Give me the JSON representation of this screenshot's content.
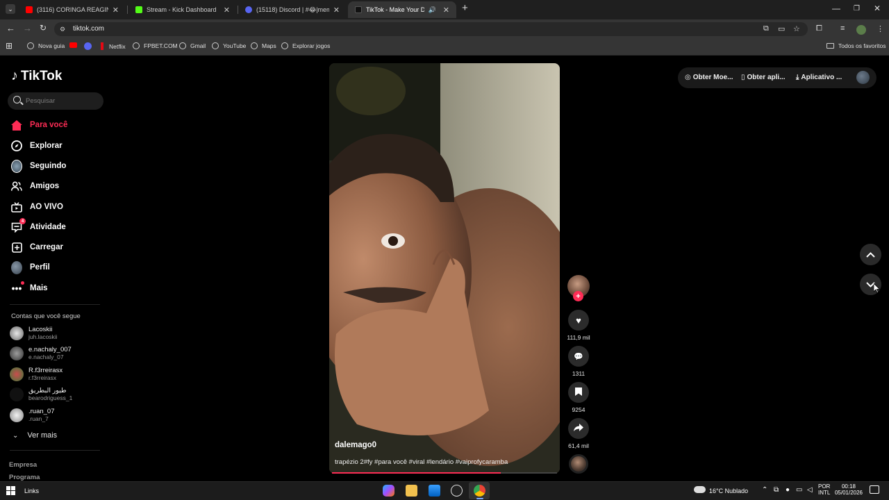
{
  "browser": {
    "tabs": [
      {
        "title": "(3116) CORINGA REAGINDO AO",
        "fav_color": "#ff0000"
      },
      {
        "title": "Stream - Kick Dashboard",
        "fav_color": "#53fc18"
      },
      {
        "title": "(15118) Discord | #😂|memes-",
        "fav_color": "#5865f2"
      },
      {
        "title": "TikTok - Make Your Day",
        "fav_color": "#111111"
      }
    ],
    "url": "tiktok.com",
    "bookmarks": [
      {
        "label": "Nova guia"
      },
      {
        "label": ""
      },
      {
        "label": ""
      },
      {
        "label": "Netflix"
      },
      {
        "label": "FPBET.COM"
      },
      {
        "label": "Gmail"
      },
      {
        "label": "YouTube"
      },
      {
        "label": "Maps"
      },
      {
        "label": "Explorar jogos"
      }
    ],
    "all_favorites": "Todos os favoritos"
  },
  "tiktok": {
    "logo": "TikTok",
    "search_placeholder": "Pesquisar",
    "nav": [
      {
        "label": "Para você",
        "icon": "home-icon"
      },
      {
        "label": "Explorar",
        "icon": "compass-icon"
      },
      {
        "label": "Seguindo",
        "icon": "following-avatar-icon"
      },
      {
        "label": "Amigos",
        "icon": "friends-icon"
      },
      {
        "label": "AO VIVO",
        "icon": "live-icon"
      },
      {
        "label": "Atividade",
        "icon": "activity-icon",
        "badge": "4"
      },
      {
        "label": "Carregar",
        "icon": "upload-icon"
      },
      {
        "label": "Perfil",
        "icon": "profile-icon"
      },
      {
        "label": "Mais",
        "icon": "more-icon"
      }
    ],
    "following_title": "Contas que você segue",
    "accounts": [
      {
        "name": "Lacoskii",
        "handle": "juh.lacoskii"
      },
      {
        "name": "e.nachaly_007",
        "handle": "e.nachaly_07"
      },
      {
        "name": "R.f3rreirasx",
        "handle": "r.f3rreirasx"
      },
      {
        "name": "طيور البطريق",
        "handle": "bearodriguess_1"
      },
      {
        "name": ".ruan_07",
        "handle": ".ruan_7"
      }
    ],
    "see_more": "Ver mais",
    "footer": [
      "Empresa",
      "Programa"
    ],
    "top_actions": [
      "Obter Moe...",
      "Obter apli...",
      "Aplicativo ..."
    ],
    "video": {
      "username": "dalemago0",
      "caption": "trapézio 2#fy #para você #viral #lendário #vaiprofycaramba",
      "likes": "111,9 mil",
      "comments": "1311",
      "saves": "9254",
      "shares": "61,4 mil",
      "progress": 0.75
    }
  },
  "taskbar": {
    "links": "Links",
    "weather": "16°C  Nublado",
    "lang1": "POR",
    "lang2": "INTL",
    "time": "00:18",
    "date": "05/01/2026"
  }
}
